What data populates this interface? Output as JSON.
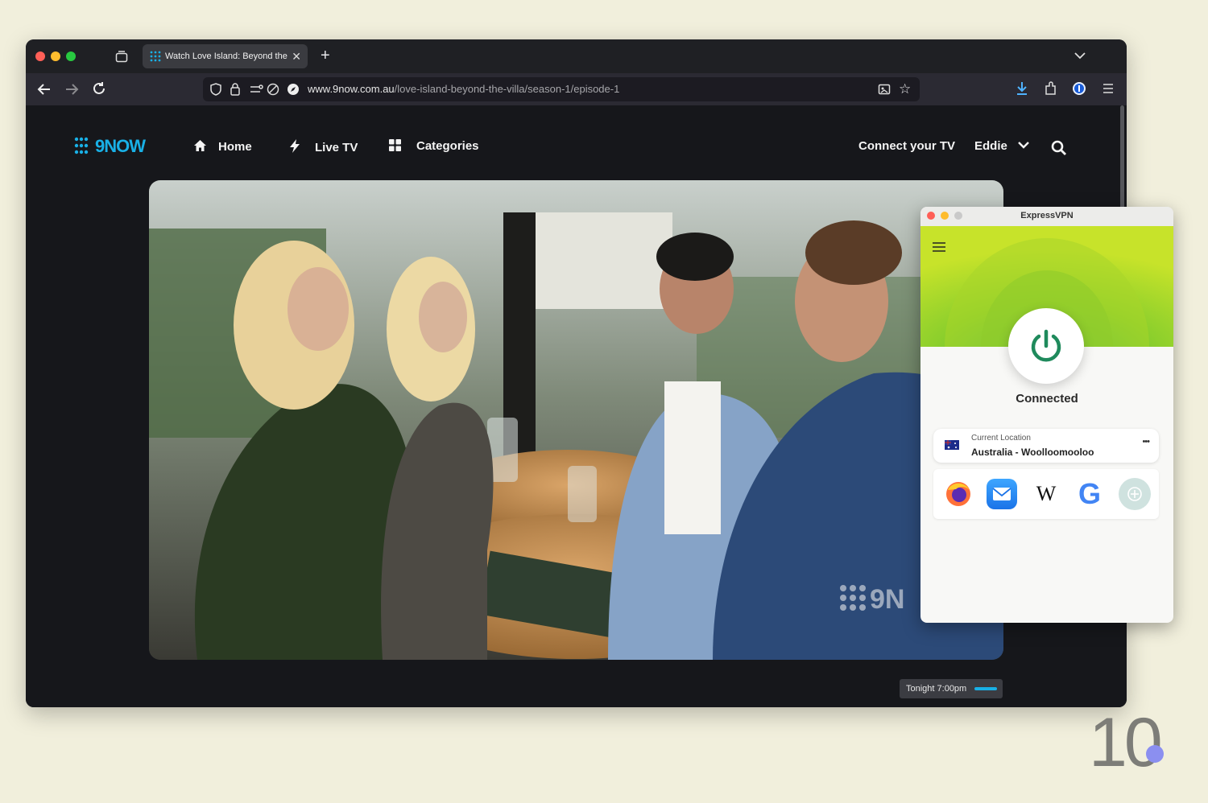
{
  "browser": {
    "tab_title": "Watch Love Island: Beyond the Villa",
    "url_domain": "www.9now.com.au",
    "url_path": "/love-island-beyond-the-villa/season-1/episode-1"
  },
  "site": {
    "logo": "9NOW",
    "nav": [
      "Home",
      "Live TV",
      "Categories"
    ],
    "connect_tv": "Connect your TV",
    "user": "Eddie",
    "badge": "Tonight 7:00pm",
    "watermark": "9N"
  },
  "vpn": {
    "title": "ExpressVPN",
    "status": "Connected",
    "location_label": "Current Location",
    "location": "Australia - Woolloomooloo",
    "more": "•••",
    "wiki_glyph": "W",
    "google_glyph": "G"
  },
  "brand": {
    "number": "10"
  },
  "colors": {
    "background": "#f1efdc",
    "vpn_green": "#9fd32a",
    "vpn_power": "#1f8a5c",
    "logo_blue": "#19b0e6"
  }
}
